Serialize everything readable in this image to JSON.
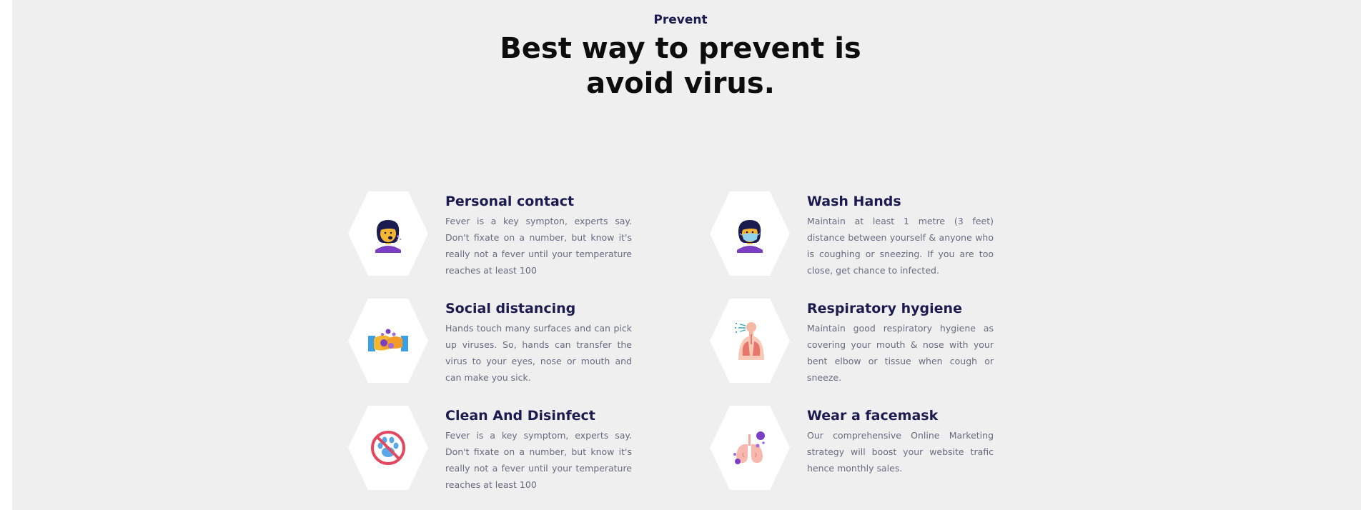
{
  "header": {
    "eyebrow": "Prevent",
    "headline_line1": "Best way to prevent is",
    "headline_line2": "avoid virus."
  },
  "cards": [
    {
      "title": "Personal contact",
      "description": "Fever is a key sympton, experts say. Don't fixate on a number, but know it's really not a fever until your temperature reaches at least 100",
      "icon": "coughing-woman-icon"
    },
    {
      "title": "Wash Hands",
      "description": "Maintain at least 1 metre (3 feet) distance between yourself & anyone who is coughing or sneezing. If you are too close, get chance to infected.",
      "icon": "woman-with-mask-icon"
    },
    {
      "title": "Social distancing",
      "description": "Hands touch many surfaces and can pick up viruses. So, hands can transfer the virus to your eyes, nose or mouth and can make you sick.",
      "icon": "handshake-virus-icon"
    },
    {
      "title": "Respiratory hygiene",
      "description": "Maintain good respiratory hygiene as covering your mouth & nose with your bent elbow or tissue when cough or sneeze.",
      "icon": "respiratory-lungs-icon"
    },
    {
      "title": "Clean And Disinfect",
      "description": "Fever is a key symptom, experts say. Don't fixate on a number, but know it's really not a fever until your temperature reaches at least 100",
      "icon": "no-pets-icon"
    },
    {
      "title": "Wear a facemask",
      "description": "Our comprehensive Online Marketing strategy will boost your website trafic hence monthly sales.",
      "icon": "infected-lungs-icon"
    }
  ],
  "colors": {
    "background": "#efefef",
    "heading": "#1c1b4f",
    "body_text": "#6a6a80",
    "hex_fill": "#ffffff"
  }
}
